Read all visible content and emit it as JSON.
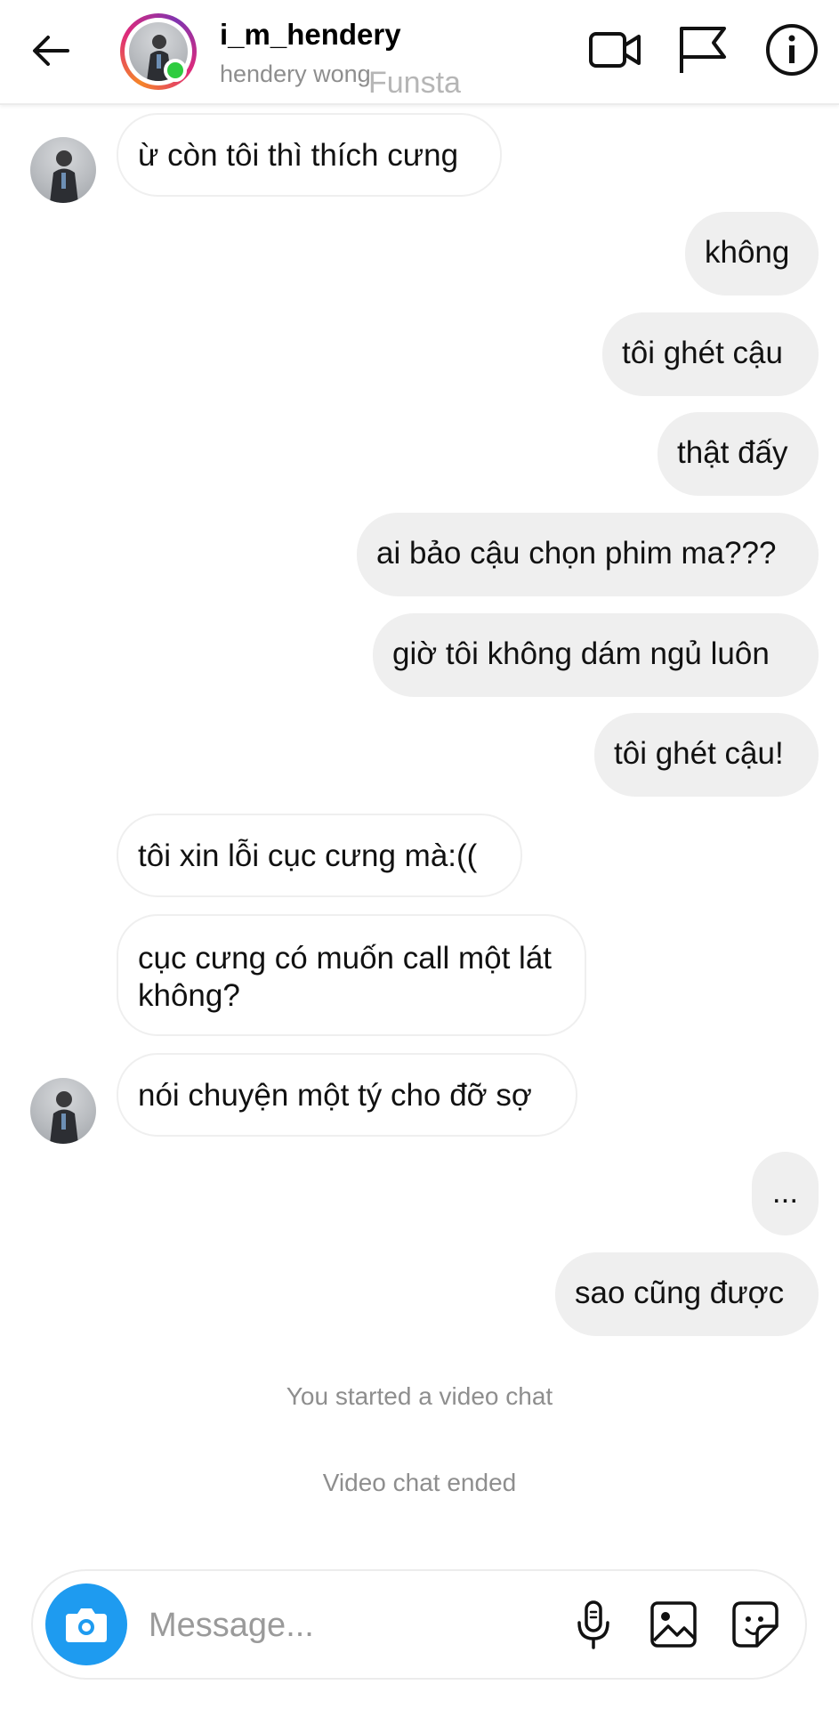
{
  "header": {
    "username": "i_m_hendery",
    "fullname": "hendery wong",
    "watermark": "Funsta",
    "online": true,
    "icons": [
      "back-arrow-icon",
      "video-call-icon",
      "flag-icon",
      "info-icon"
    ]
  },
  "messages": [
    {
      "side": "in",
      "text": "ừ còn tôi thì thích cưng",
      "avatar": true
    },
    {
      "side": "out",
      "text": "không"
    },
    {
      "side": "out",
      "text": "tôi ghét cậu"
    },
    {
      "side": "out",
      "text": "thật đấy"
    },
    {
      "side": "out",
      "text": "ai bảo cậu chọn phim ma???"
    },
    {
      "side": "out",
      "text": "giờ tôi không dám ngủ luôn"
    },
    {
      "side": "out",
      "text": "tôi ghét cậu!"
    },
    {
      "side": "in",
      "text": "tôi xin lỗi cục cưng mà:(("
    },
    {
      "side": "in",
      "text": "cục cưng có muốn call một lát không?"
    },
    {
      "side": "in",
      "text": "nói chuyện một tý cho đỡ sợ",
      "avatar": true
    },
    {
      "side": "out",
      "text": "..."
    },
    {
      "side": "out",
      "text": "sao cũng được"
    }
  ],
  "system": {
    "video_started": "You started a video chat",
    "video_ended": "Video chat ended"
  },
  "composer": {
    "placeholder": "Message...",
    "value": "",
    "icons": [
      "camera-icon",
      "microphone-icon",
      "gallery-icon",
      "sticker-icon"
    ],
    "camera_color": "#1e9bf0"
  },
  "colors": {
    "outgoing_bubble": "#efefef",
    "incoming_bubble": "#ffffff",
    "online": "#2ecc40"
  }
}
